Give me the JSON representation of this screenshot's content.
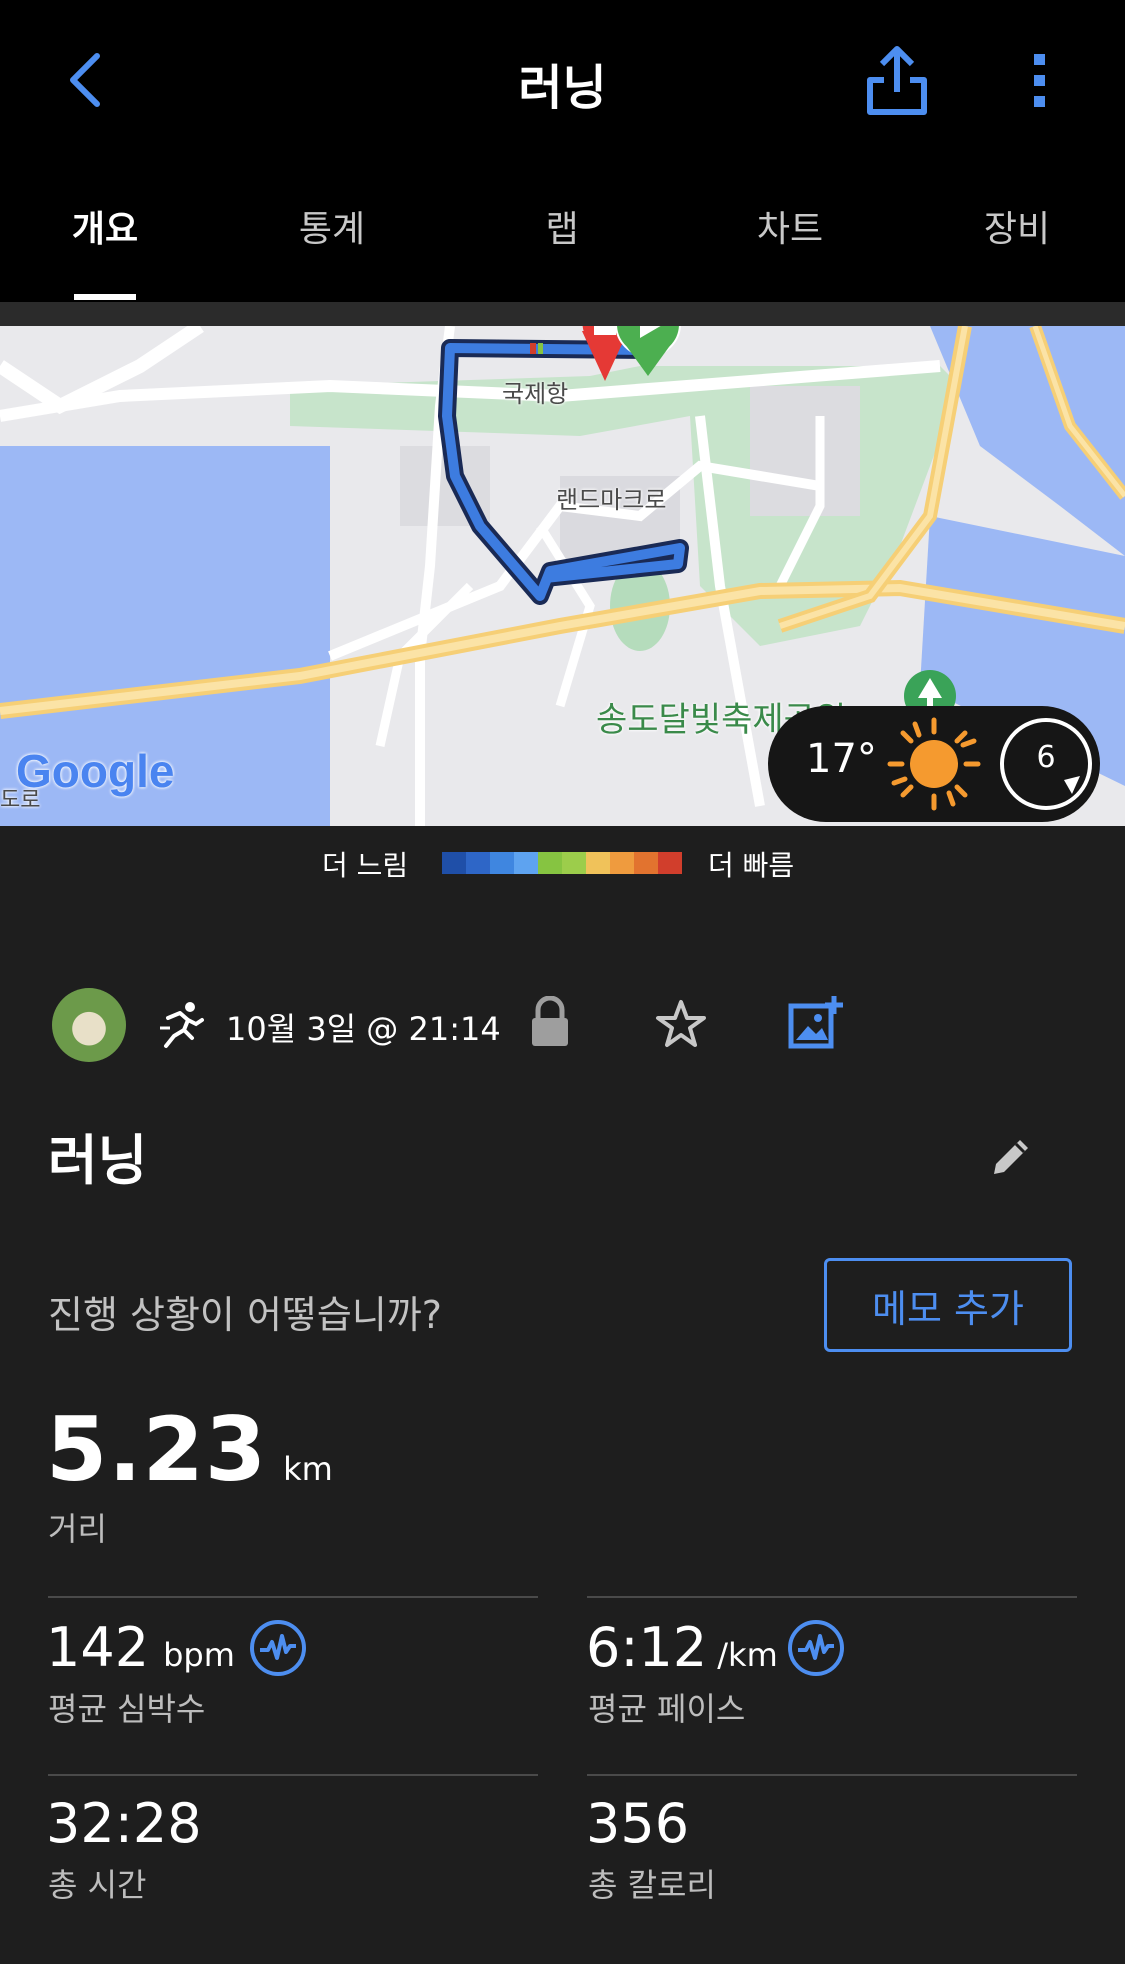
{
  "header": {
    "title": "러닝"
  },
  "tabs": [
    {
      "label": "개요",
      "active": true
    },
    {
      "label": "통계",
      "active": false
    },
    {
      "label": "랩",
      "active": false
    },
    {
      "label": "차트",
      "active": false
    },
    {
      "label": "장비",
      "active": false
    }
  ],
  "map": {
    "labels": {
      "place1": "국제항",
      "place2": "랜드마크로",
      "park": "송도달빛축제공원",
      "corner": "도로",
      "google": "Google"
    },
    "route_color": "#3d7ce0",
    "weather": {
      "temperature": "17°",
      "wind_value": "6"
    }
  },
  "legend": {
    "slower": "더 느림",
    "faster": "더 빠름",
    "colors": [
      "#1f4fa8",
      "#2e66c7",
      "#3f86e0",
      "#5ea3f0",
      "#86c441",
      "#9ccd4b",
      "#f0c25a",
      "#ef9b3e",
      "#e2732f",
      "#d13e2c"
    ]
  },
  "activity": {
    "date_time": "10월 3일 @ 21:14",
    "name": "러닝",
    "prompt": "진행 상황이 어떻습니까?",
    "add_memo_button": "메모 추가"
  },
  "stats": {
    "distance": {
      "value": "5.23",
      "unit": "km",
      "label": "거리"
    },
    "avg_hr": {
      "value": "142",
      "unit": "bpm",
      "label": "평균 심박수"
    },
    "avg_pace": {
      "value": "6:12",
      "unit": "/km",
      "label": "평균 페이스"
    },
    "total_time": {
      "value": "32:28",
      "label": "총 시간"
    },
    "calories": {
      "value": "356",
      "label": "총 칼로리"
    }
  },
  "accent_color": "#4d8ef0"
}
